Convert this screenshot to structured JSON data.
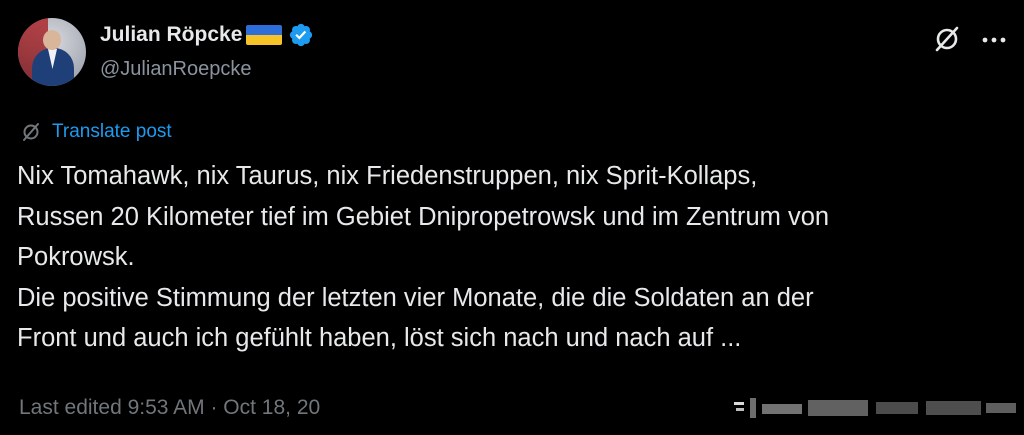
{
  "author": {
    "display_name": "Julian Röpcke",
    "handle": "@JulianRoepcke",
    "flag_icon": "ukraine-flag-icon",
    "verified_icon": "verified-badge-icon"
  },
  "header_actions": {
    "grok_icon": "grok-icon",
    "more_icon": "more-icon"
  },
  "translate": {
    "label": "Translate post"
  },
  "post": {
    "lines": [
      "Nix Tomahawk, nix Taurus, nix Friedenstruppen, nix Sprit-Kollaps,",
      "Russen 20 Kilometer tief im Gebiet Dnipropetrowsk und im Zentrum von",
      "Pokrowsk.",
      "Die positive Stimmung der letzten vier Monate, die die Soldaten an der",
      "Front und auch ich gefühlt haben, löst sich nach und nach auf ..."
    ]
  },
  "meta": {
    "last_edited": "Last edited 9:53 AM · Oct 18, 20"
  },
  "colors": {
    "background": "#000000",
    "text": "#e7e9ea",
    "secondary": "#71767b",
    "accent": "#1d9bf0",
    "verified": "#1d9bf0",
    "flag_blue": "#2f6ed8",
    "flag_yellow": "#f6c427"
  }
}
